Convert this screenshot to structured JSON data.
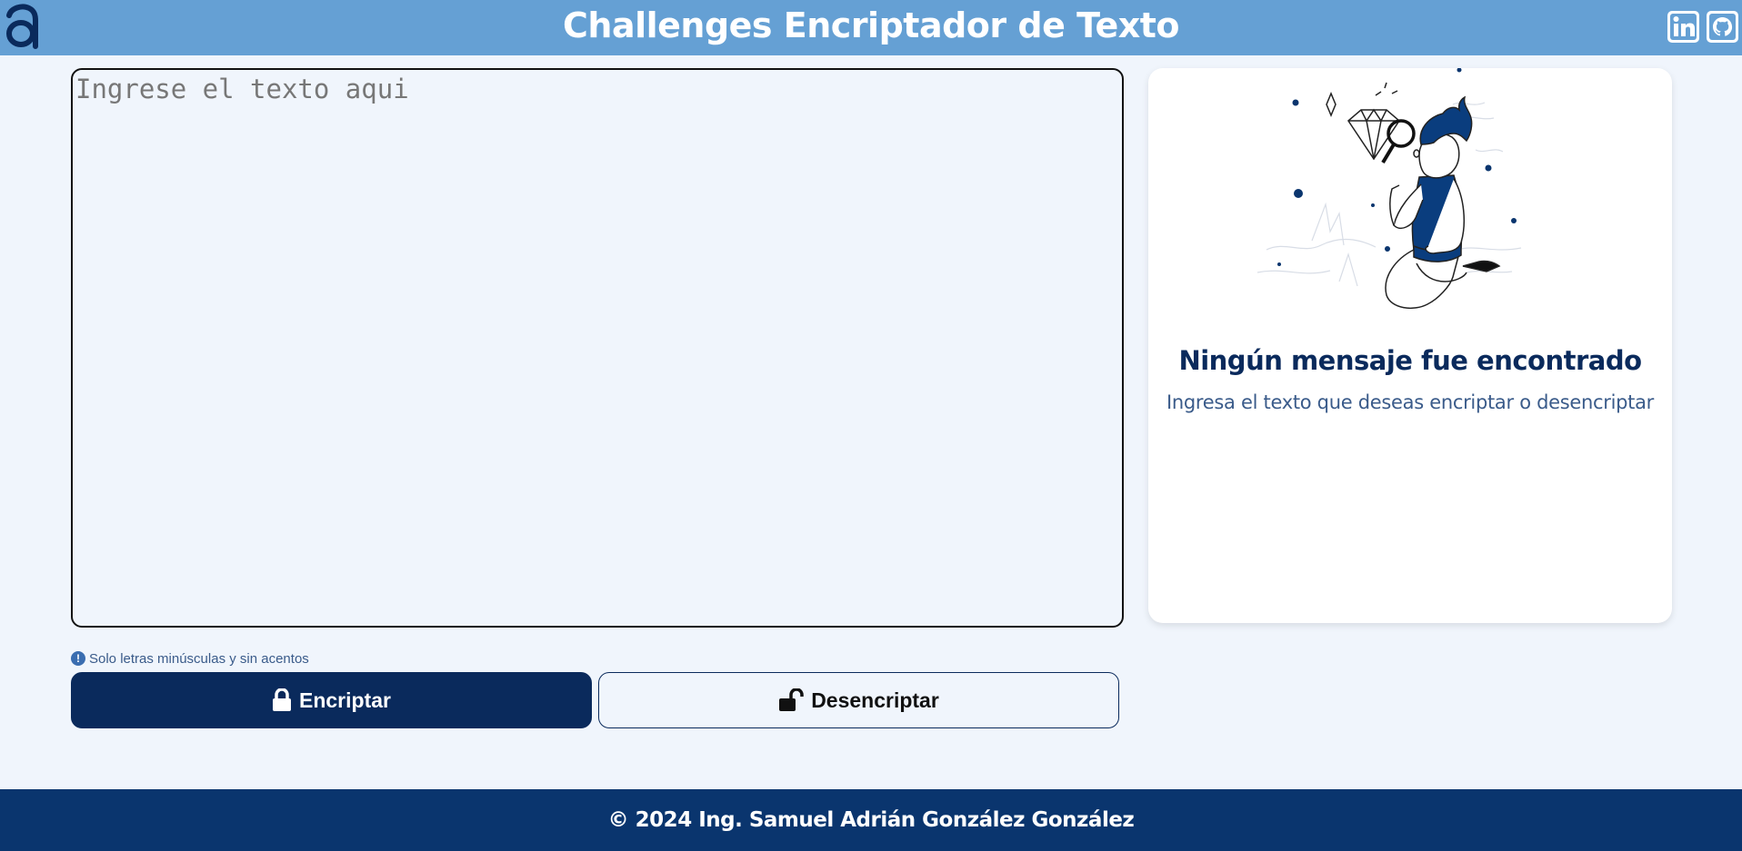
{
  "header": {
    "title": "Challenges Encriptador de Texto",
    "logo_icon": "alura-logo-icon",
    "social": [
      {
        "name": "linkedin-icon"
      },
      {
        "name": "github-icon"
      }
    ]
  },
  "editor": {
    "placeholder": "Ingrese el texto aqui",
    "value": ""
  },
  "hint": {
    "icon": "exclamation-circle-icon",
    "text": "Solo letras minúsculas y sin acentos"
  },
  "buttons": {
    "encrypt_label": "Encriptar",
    "decrypt_label": "Desencriptar"
  },
  "result": {
    "title": "Ningún mensaje fue encontrado",
    "subtitle": "Ingresa el texto que deseas encriptar o desencriptar",
    "illustration": "searching-person-illustration"
  },
  "footer": {
    "text": "© 2024 Ing. Samuel Adrián González González"
  },
  "colors": {
    "header_bg": "#65a0d4",
    "primary": "#0a2a5c",
    "footer_bg": "#0a356e",
    "page_bg": "#f0f5fc"
  }
}
